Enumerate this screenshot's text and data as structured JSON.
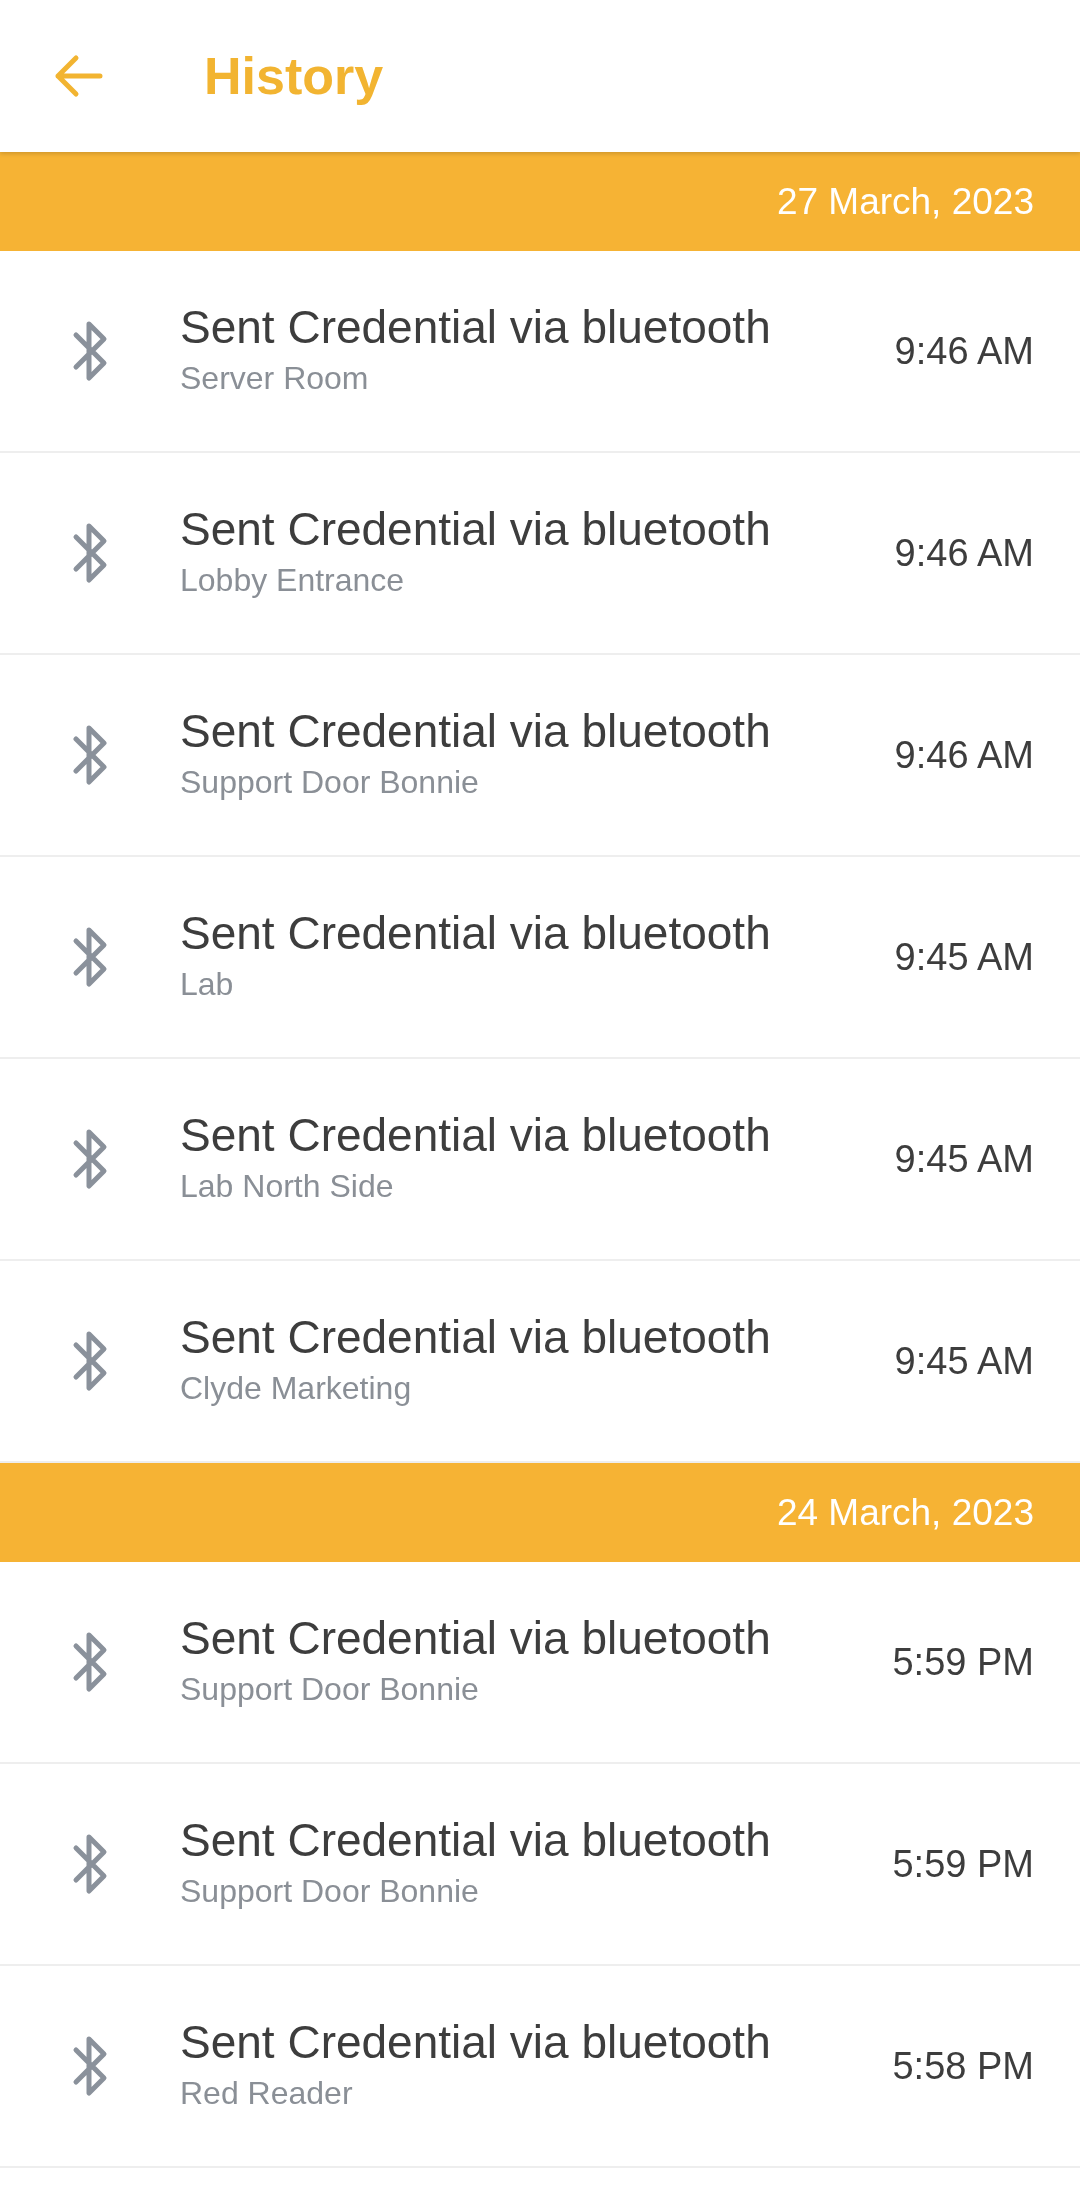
{
  "header": {
    "title": "History"
  },
  "sections": [
    {
      "date": "27 March, 2023",
      "entries": [
        {
          "title": "Sent Credential via bluetooth",
          "location": "Server Room",
          "time": "9:46 AM"
        },
        {
          "title": "Sent Credential via bluetooth",
          "location": "Lobby Entrance",
          "time": "9:46 AM"
        },
        {
          "title": "Sent Credential via bluetooth",
          "location": "Support Door Bonnie",
          "time": "9:46 AM"
        },
        {
          "title": "Sent Credential via bluetooth",
          "location": "Lab",
          "time": "9:45 AM"
        },
        {
          "title": "Sent Credential via bluetooth",
          "location": "Lab North Side",
          "time": "9:45 AM"
        },
        {
          "title": "Sent Credential via bluetooth",
          "location": "Clyde Marketing",
          "time": "9:45 AM"
        }
      ]
    },
    {
      "date": "24 March, 2023",
      "entries": [
        {
          "title": "Sent Credential via bluetooth",
          "location": "Support Door Bonnie",
          "time": "5:59 PM"
        },
        {
          "title": "Sent Credential via bluetooth",
          "location": "Support Door Bonnie",
          "time": "5:59 PM"
        },
        {
          "title": "Sent Credential via bluetooth",
          "location": "Red Reader",
          "time": "5:58 PM"
        }
      ]
    }
  ]
}
